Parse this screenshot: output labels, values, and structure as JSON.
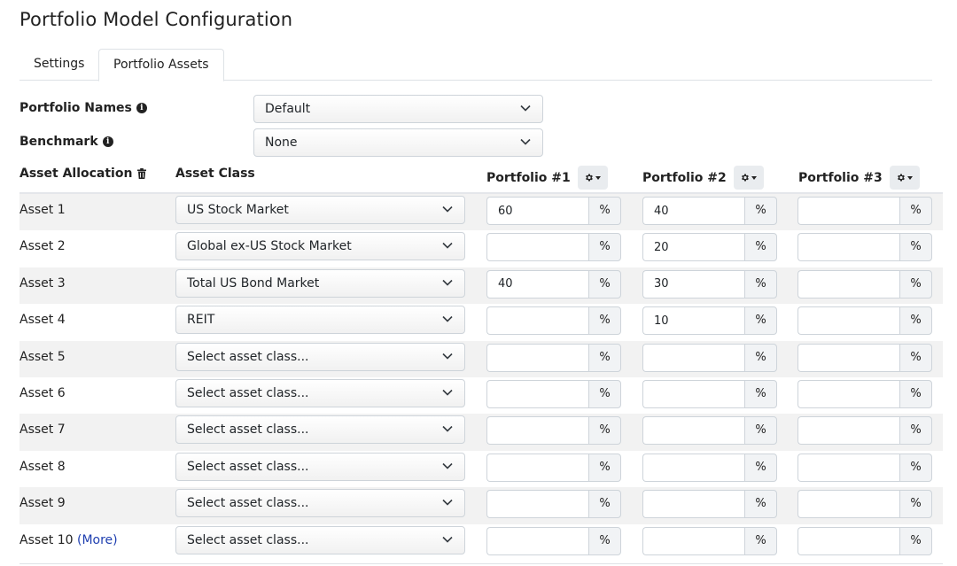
{
  "page": {
    "title": "Portfolio Model Configuration"
  },
  "tabs": [
    {
      "label": "Settings",
      "active": false
    },
    {
      "label": "Portfolio Assets",
      "active": true
    }
  ],
  "portfolio_names": {
    "label": "Portfolio Names",
    "value": "Default"
  },
  "benchmark": {
    "label": "Benchmark",
    "value": "None"
  },
  "table": {
    "headers": {
      "allocation": "Asset Allocation",
      "asset_class": "Asset Class",
      "p1": "Portfolio #1",
      "p2": "Portfolio #2",
      "p3": "Portfolio #3"
    },
    "percent_symbol": "%",
    "more_link": "(More)",
    "rows": [
      {
        "label": "Asset 1",
        "asset_class": "US Stock Market",
        "p1": "60",
        "p2": "40",
        "p3": ""
      },
      {
        "label": "Asset 2",
        "asset_class": "Global ex-US Stock Market",
        "p1": "",
        "p2": "20",
        "p3": ""
      },
      {
        "label": "Asset 3",
        "asset_class": "Total US Bond Market",
        "p1": "40",
        "p2": "30",
        "p3": ""
      },
      {
        "label": "Asset 4",
        "asset_class": "REIT",
        "p1": "",
        "p2": "10",
        "p3": ""
      },
      {
        "label": "Asset 5",
        "asset_class": "Select asset class...",
        "p1": "",
        "p2": "",
        "p3": ""
      },
      {
        "label": "Asset 6",
        "asset_class": "Select asset class...",
        "p1": "",
        "p2": "",
        "p3": ""
      },
      {
        "label": "Asset 7",
        "asset_class": "Select asset class...",
        "p1": "",
        "p2": "",
        "p3": ""
      },
      {
        "label": "Asset 8",
        "asset_class": "Select asset class...",
        "p1": "",
        "p2": "",
        "p3": ""
      },
      {
        "label": "Asset 9",
        "asset_class": "Select asset class...",
        "p1": "",
        "p2": "",
        "p3": ""
      },
      {
        "label": "Asset 10",
        "asset_class": "Select asset class...",
        "p1": "",
        "p2": "",
        "p3": ""
      }
    ]
  }
}
